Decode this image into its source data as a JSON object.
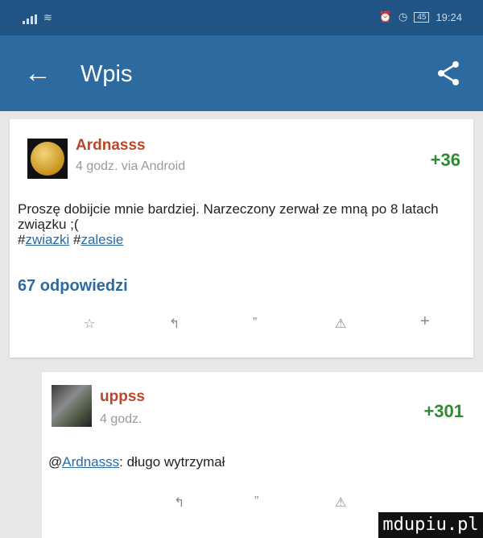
{
  "status_bar": {
    "time": "19:24",
    "battery": "45"
  },
  "app_bar": {
    "back_icon": "arrow-left-icon",
    "title": "Wpis",
    "share_icon": "share-icon"
  },
  "post": {
    "author": "Ardnasss",
    "meta": "4 godz. via Android",
    "score": "+36",
    "text": "Proszę dobijcie mnie bardziej. Narzeczony zerwał ze mną po 8 latach związku ;(",
    "hash1": "#",
    "tag1": "zwiazki",
    "hash2": " #",
    "tag2": "zalesie",
    "replies_label": "67 odpowiedzi",
    "actions": {
      "star": "☆",
      "reply": "↰",
      "quote": "”",
      "report": "⚠",
      "plus": "+"
    }
  },
  "comment": {
    "author": "uppss",
    "meta": "4 godz.",
    "score": "+301",
    "at": "@",
    "mention": "Ardnasss",
    "text": ": długo wytrzymał",
    "actions": {
      "reply": "↰",
      "quote": "”",
      "report": "⚠"
    }
  },
  "watermark": "mdupiu.pl"
}
